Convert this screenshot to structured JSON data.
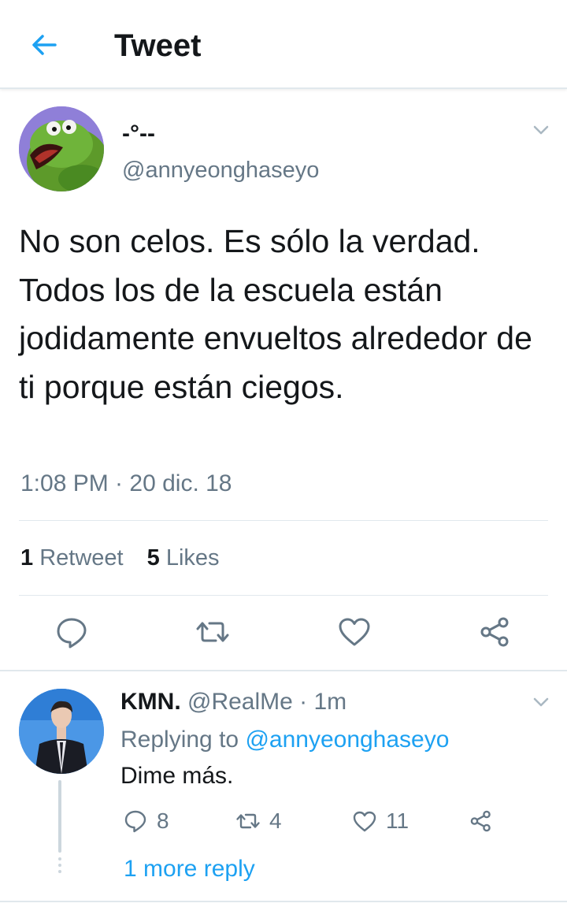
{
  "header": {
    "title": "Tweet"
  },
  "tweet": {
    "display_name": "-°--",
    "handle": "@annyeonghaseyo",
    "text": "No son celos. Es sólo la verdad. Todos los de la escuela están jodidamente envueltos alrededor de ti porque están ciegos.",
    "timestamp": "1:08 PM · 20 dic. 18",
    "retweets_count": "1",
    "retweets_label": "Retweet",
    "likes_count": "5",
    "likes_label": "Likes"
  },
  "reply": {
    "display_name": "KMN.",
    "handle": "@RealMe",
    "time": "· 1m",
    "replying_prefix": "Replying to",
    "replying_to": "@annyeonghaseyo",
    "text": "Dime más.",
    "reply_count": "8",
    "retweet_count": "4",
    "like_count": "11",
    "more_replies": "1 more reply"
  },
  "icons": {
    "back": "arrow-left-icon",
    "chevron": "chevron-down-icon",
    "reply": "reply-icon",
    "retweet": "retweet-icon",
    "like": "heart-icon",
    "share": "share-icon"
  },
  "colors": {
    "accent": "#1da1f2",
    "secondary_text": "#657786",
    "primary_text": "#14171a",
    "divider": "#e1e8ed"
  }
}
